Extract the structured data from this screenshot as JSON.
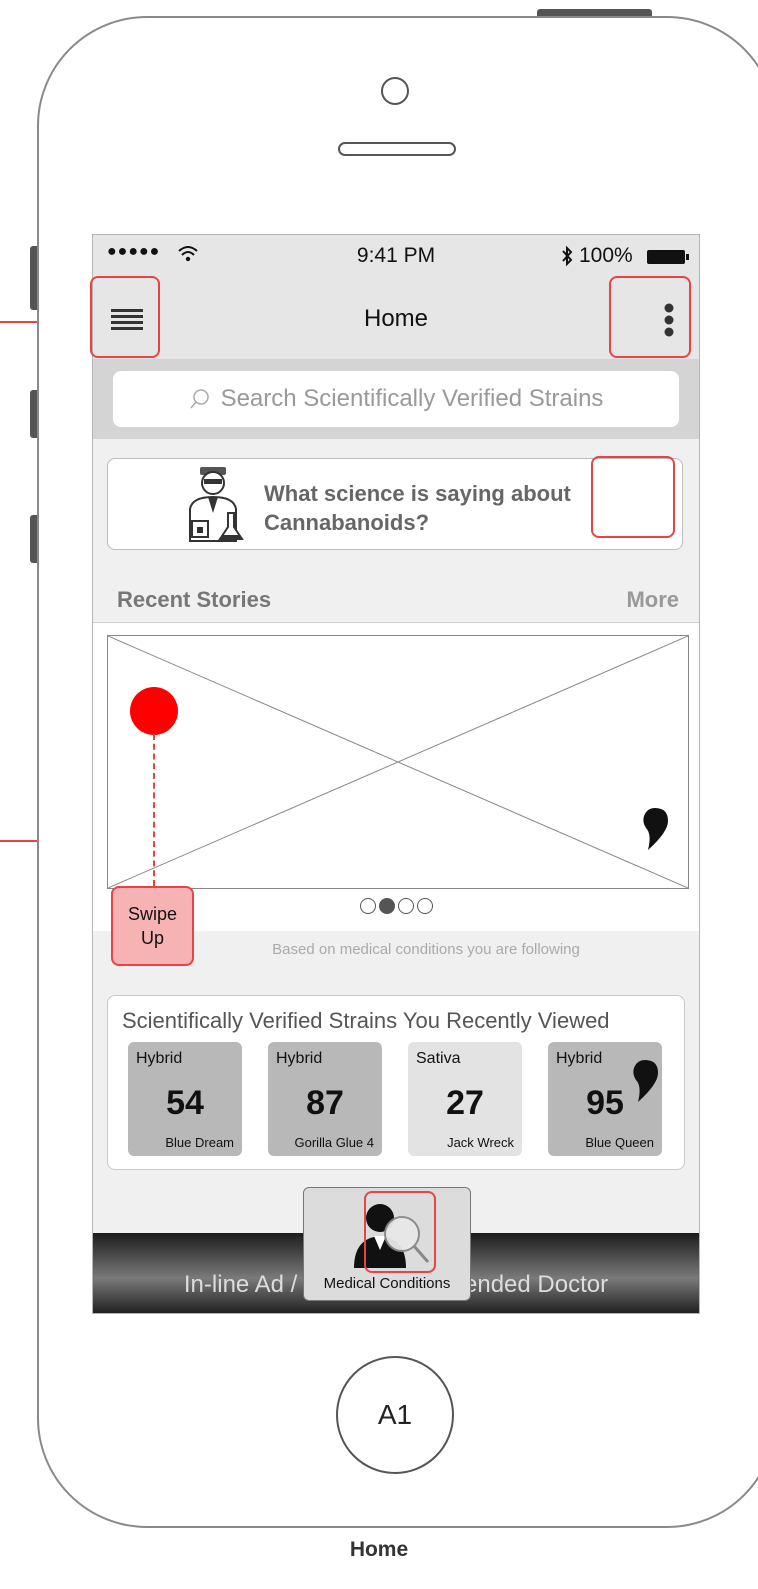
{
  "status_bar": {
    "signal": "●●●●●",
    "time": "9:41 PM",
    "battery": "100%"
  },
  "nav": {
    "title": "Home",
    "menu_icon": "hamburger-icon",
    "overflow_icon": "vertical-dots-icon"
  },
  "search": {
    "placeholder": "Search Scientifically Verified Strains"
  },
  "science_card": {
    "text_line1": "What science is saying about",
    "text_line2": "Cannabanoids?"
  },
  "recent_stories": {
    "heading": "Recent Stories",
    "more_label": "More",
    "page_count": 4,
    "active_page": 2
  },
  "swipe_note": {
    "line1": "Swipe",
    "line2": "Up"
  },
  "based_text": "Based on medical conditions you are following",
  "strains": {
    "title": "Scientifically Verified Strains You Recently Viewed",
    "items": [
      {
        "type": "Hybrid",
        "score": "54",
        "name": "Blue Dream",
        "color": "#b8b8b8"
      },
      {
        "type": "Hybrid",
        "score": "87",
        "name": "Gorilla Glue 4",
        "color": "#b8b8b8"
      },
      {
        "type": "Sativa",
        "score": "27",
        "name": "Jack Wreck",
        "color": "#e3e3e3"
      },
      {
        "type": "Hybrid",
        "score": "95",
        "name": "Blue Queen",
        "color": "#b8b8b8"
      }
    ]
  },
  "ad": {
    "text": "In-line Ad / Local Recommended Doctor"
  },
  "medical_button": {
    "label": "Medical Conditions"
  },
  "home_button": {
    "label": "A1"
  },
  "page_caption": "Home",
  "colors": {
    "annotation": "#e64545",
    "hotspot_fill": "#f7b3b3",
    "marker": "#ff0000"
  }
}
